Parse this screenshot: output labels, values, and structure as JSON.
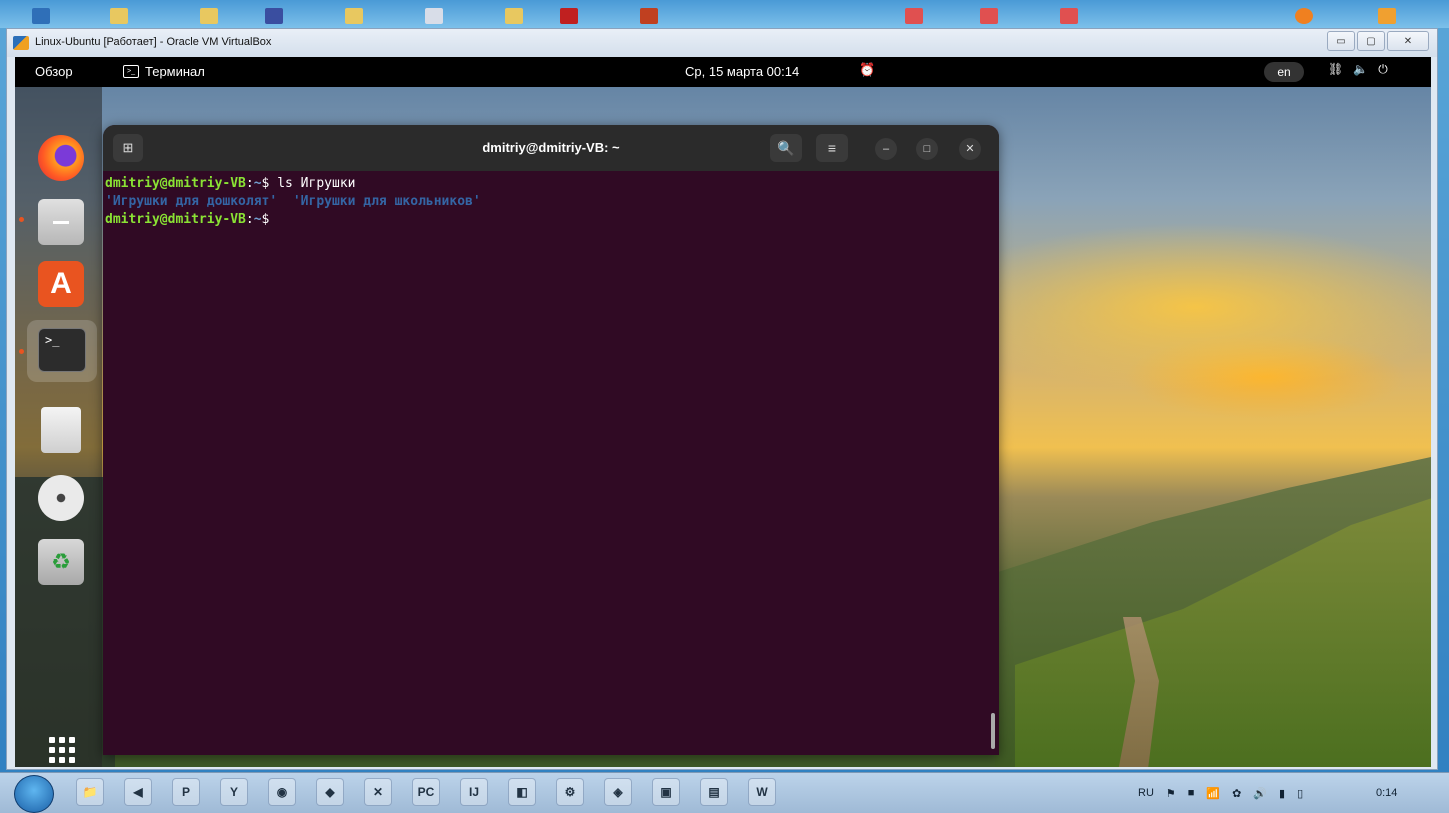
{
  "vbox": {
    "title": "Linux-Ubuntu [Работает] - Oracle VM VirtualBox",
    "controls": [
      "▭",
      "▢",
      "✕"
    ]
  },
  "topbar": {
    "overview": "Обзор",
    "app_name": "Терминал",
    "clock": "Ср, 15 марта  00:14",
    "lang": "en"
  },
  "terminal": {
    "title": "dmitriy@dmitriy-VB: ~",
    "lines": [
      {
        "user": "dmitriy@dmitriy-VB",
        "path": "~",
        "cmd": " ls Игрушки"
      },
      {
        "output": "'Игрушки для дошколят'  'Игрушки для школьников'"
      },
      {
        "user": "dmitriy@dmitriy-VB",
        "path": "~",
        "cmd": " "
      }
    ],
    "colors": {
      "background": "#300a24",
      "user": "#8ae234",
      "path": "#729fcf",
      "dir": "#3465a4"
    }
  },
  "dock": {
    "icons": [
      "firefox-icon",
      "files-icon",
      "app-center-icon",
      "terminal-icon",
      "vbox-additions-icon",
      "disc-icon",
      "trash-icon",
      "show-apps-icon"
    ]
  },
  "taskbar": {
    "tray_lang": "RU",
    "time": "0:14",
    "items": [
      "📁",
      "◀",
      "P",
      "Y",
      "◉",
      "◆",
      "✕",
      "PC",
      "IJ",
      "◧",
      "⚙",
      "◈",
      "▣",
      "▤",
      "W"
    ]
  }
}
